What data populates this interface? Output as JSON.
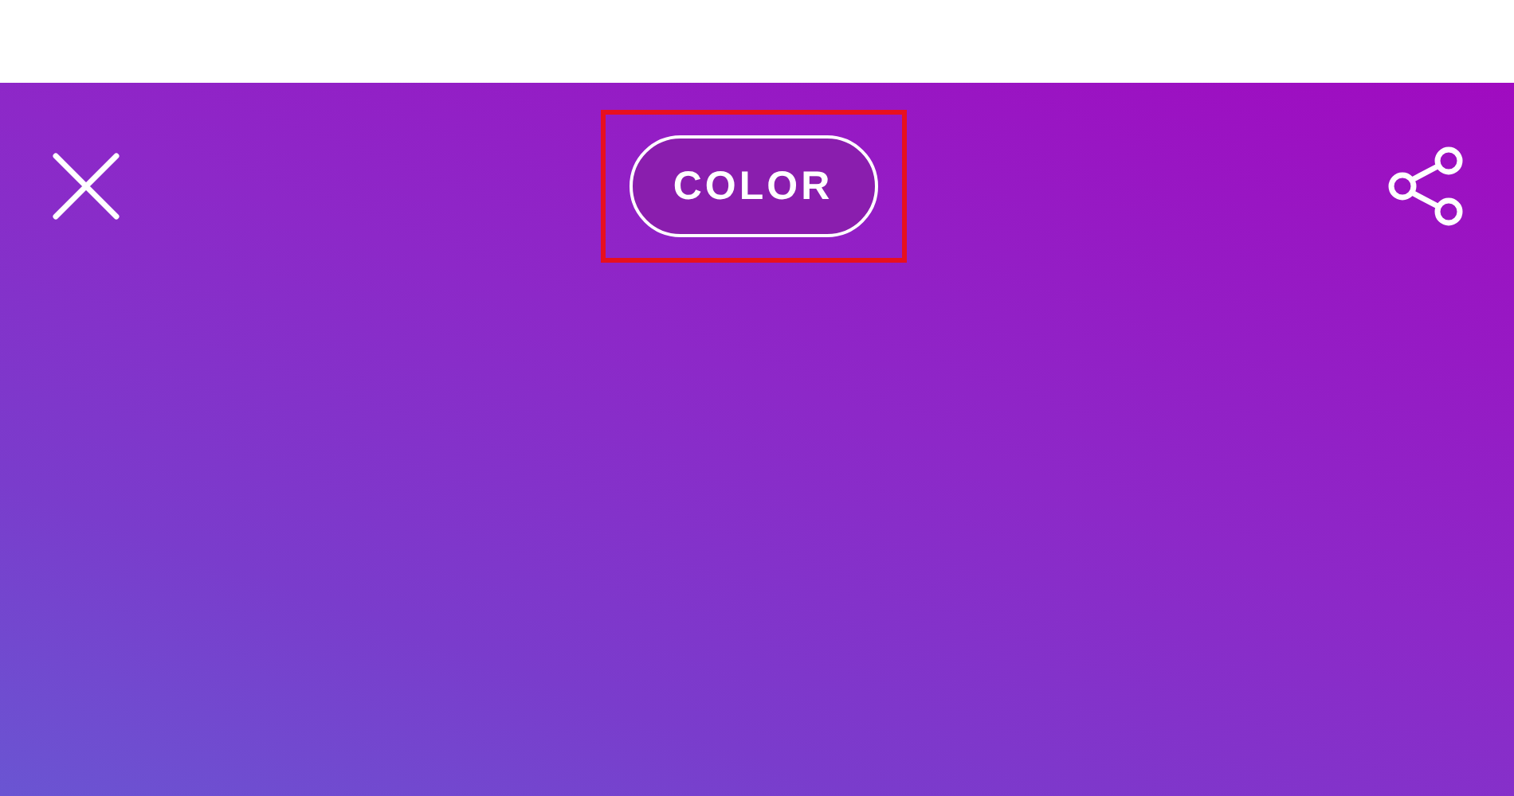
{
  "toolbar": {
    "mode_button": {
      "label": "COLOR",
      "highlighted": true
    }
  }
}
